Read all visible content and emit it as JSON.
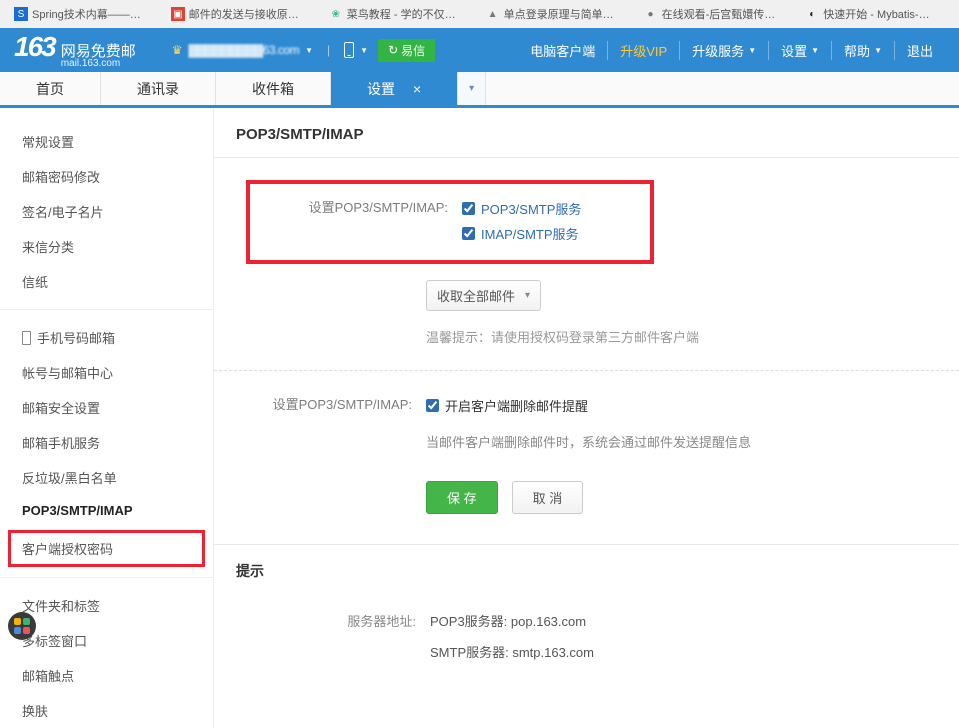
{
  "browser_tabs": [
    {
      "icon_cls": "fav-blue",
      "icon": "S",
      "label": "Spring技术内幕——…"
    },
    {
      "icon_cls": "fav-red",
      "icon": "▣",
      "label": "邮件的发送与接收原…"
    },
    {
      "icon_cls": "fav-green",
      "icon": "❀",
      "label": "菜鸟教程 - 学的不仅…"
    },
    {
      "icon_cls": "fav-gray",
      "icon": "▲",
      "label": "单点登录原理与简单…"
    },
    {
      "icon_cls": "fav-gray",
      "icon": "●",
      "label": "在线观看-后宫甄嬛传…"
    },
    {
      "icon_cls": "fav-dark",
      "icon": "◐",
      "label": "快速开始 - Mybatis-…"
    }
  ],
  "logo": {
    "num": "163",
    "cn": "网易免费邮",
    "en": "mail.163.com"
  },
  "user": {
    "email_masked": "▓▓▓▓▓▓▓▓▓63.com"
  },
  "yixin": "易信",
  "header_links": {
    "pc_client": "电脑客户端",
    "vip": "升级VIP",
    "upgrade_service": "升级服务",
    "settings": "设置",
    "help": "帮助",
    "logout": "退出"
  },
  "nav": {
    "home": "首页",
    "contacts": "通讯录",
    "inbox": "收件箱",
    "settings": "设置"
  },
  "sidebar": {
    "group1": [
      "常规设置",
      "邮箱密码修改",
      "签名/电子名片",
      "来信分类",
      "信纸"
    ],
    "group2_first": "手机号码邮箱",
    "group2": [
      "帐号与邮箱中心",
      "邮箱安全设置",
      "邮箱手机服务",
      "反垃圾/黑白名单"
    ],
    "pop3_item": "POP3/SMTP/IMAP",
    "client_auth": "客户端授权密码",
    "group3": [
      "文件夹和标签",
      "多标签窗口",
      "邮箱触点",
      "换肤"
    ]
  },
  "main": {
    "title": "POP3/SMTP/IMAP",
    "setting_label": "设置POP3/SMTP/IMAP:",
    "chk_pop3": "POP3/SMTP服务",
    "chk_imap": "IMAP/SMTP服务",
    "dropdown": "收取全部邮件",
    "tip1": "温馨提示：请使用授权码登录第三方邮件客户端",
    "del_label": "设置POP3/SMTP/IMAP:",
    "chk_del": "开启客户端删除邮件提醒",
    "del_info": "当邮件客户端删除邮件时，系统会通过邮件发送提醒信息",
    "save": "保 存",
    "cancel": "取 消",
    "tips_title": "提示",
    "server_label": "服务器地址:",
    "pop3_server": "POP3服务器: pop.163.com",
    "smtp_server": "SMTP服务器: smtp.163.com"
  }
}
